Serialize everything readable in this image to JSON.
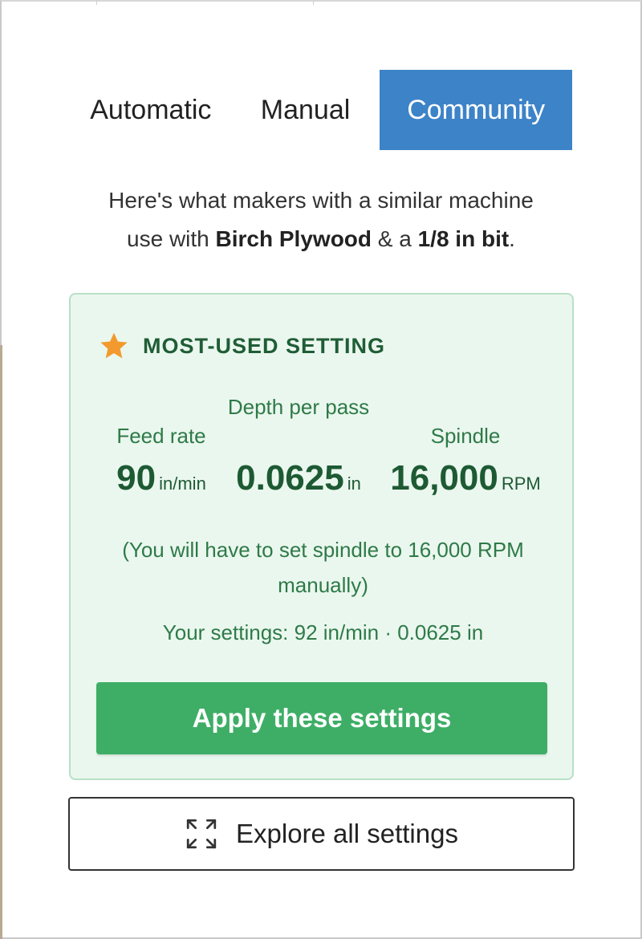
{
  "tabs": [
    {
      "label": "Automatic",
      "active": false
    },
    {
      "label": "Manual",
      "active": false
    },
    {
      "label": "Community",
      "active": true
    }
  ],
  "intro": {
    "line1": "Here's what makers with a similar machine",
    "line2_prefix": "use with ",
    "material": "Birch Plywood",
    "connector": " & a ",
    "bit": "1/8 in bit",
    "suffix": "."
  },
  "card": {
    "icon": "star-icon",
    "title": "MOST-USED SETTING",
    "metrics": [
      {
        "label": "Feed rate",
        "value": "90",
        "unit": "in/min"
      },
      {
        "label": "Depth per pass",
        "value": "0.0625",
        "unit": "in"
      },
      {
        "label": "Spindle",
        "value": "16,000",
        "unit": "RPM"
      }
    ],
    "note": "(You will have to set spindle to 16,000 RPM manually)",
    "your_settings": "Your settings: 92 in/min · 0.0625 in",
    "apply_label": "Apply these settings"
  },
  "explore": {
    "icon": "expand-icon",
    "label": "Explore all settings"
  },
  "colors": {
    "tab_active": "#3d83c8",
    "card_bg": "#eaf7ee",
    "card_border": "#b9e0c6",
    "title_green": "#1f5d35",
    "text_green": "#2e7a48",
    "apply_button": "#3eae66",
    "star": "#f29a2e"
  }
}
